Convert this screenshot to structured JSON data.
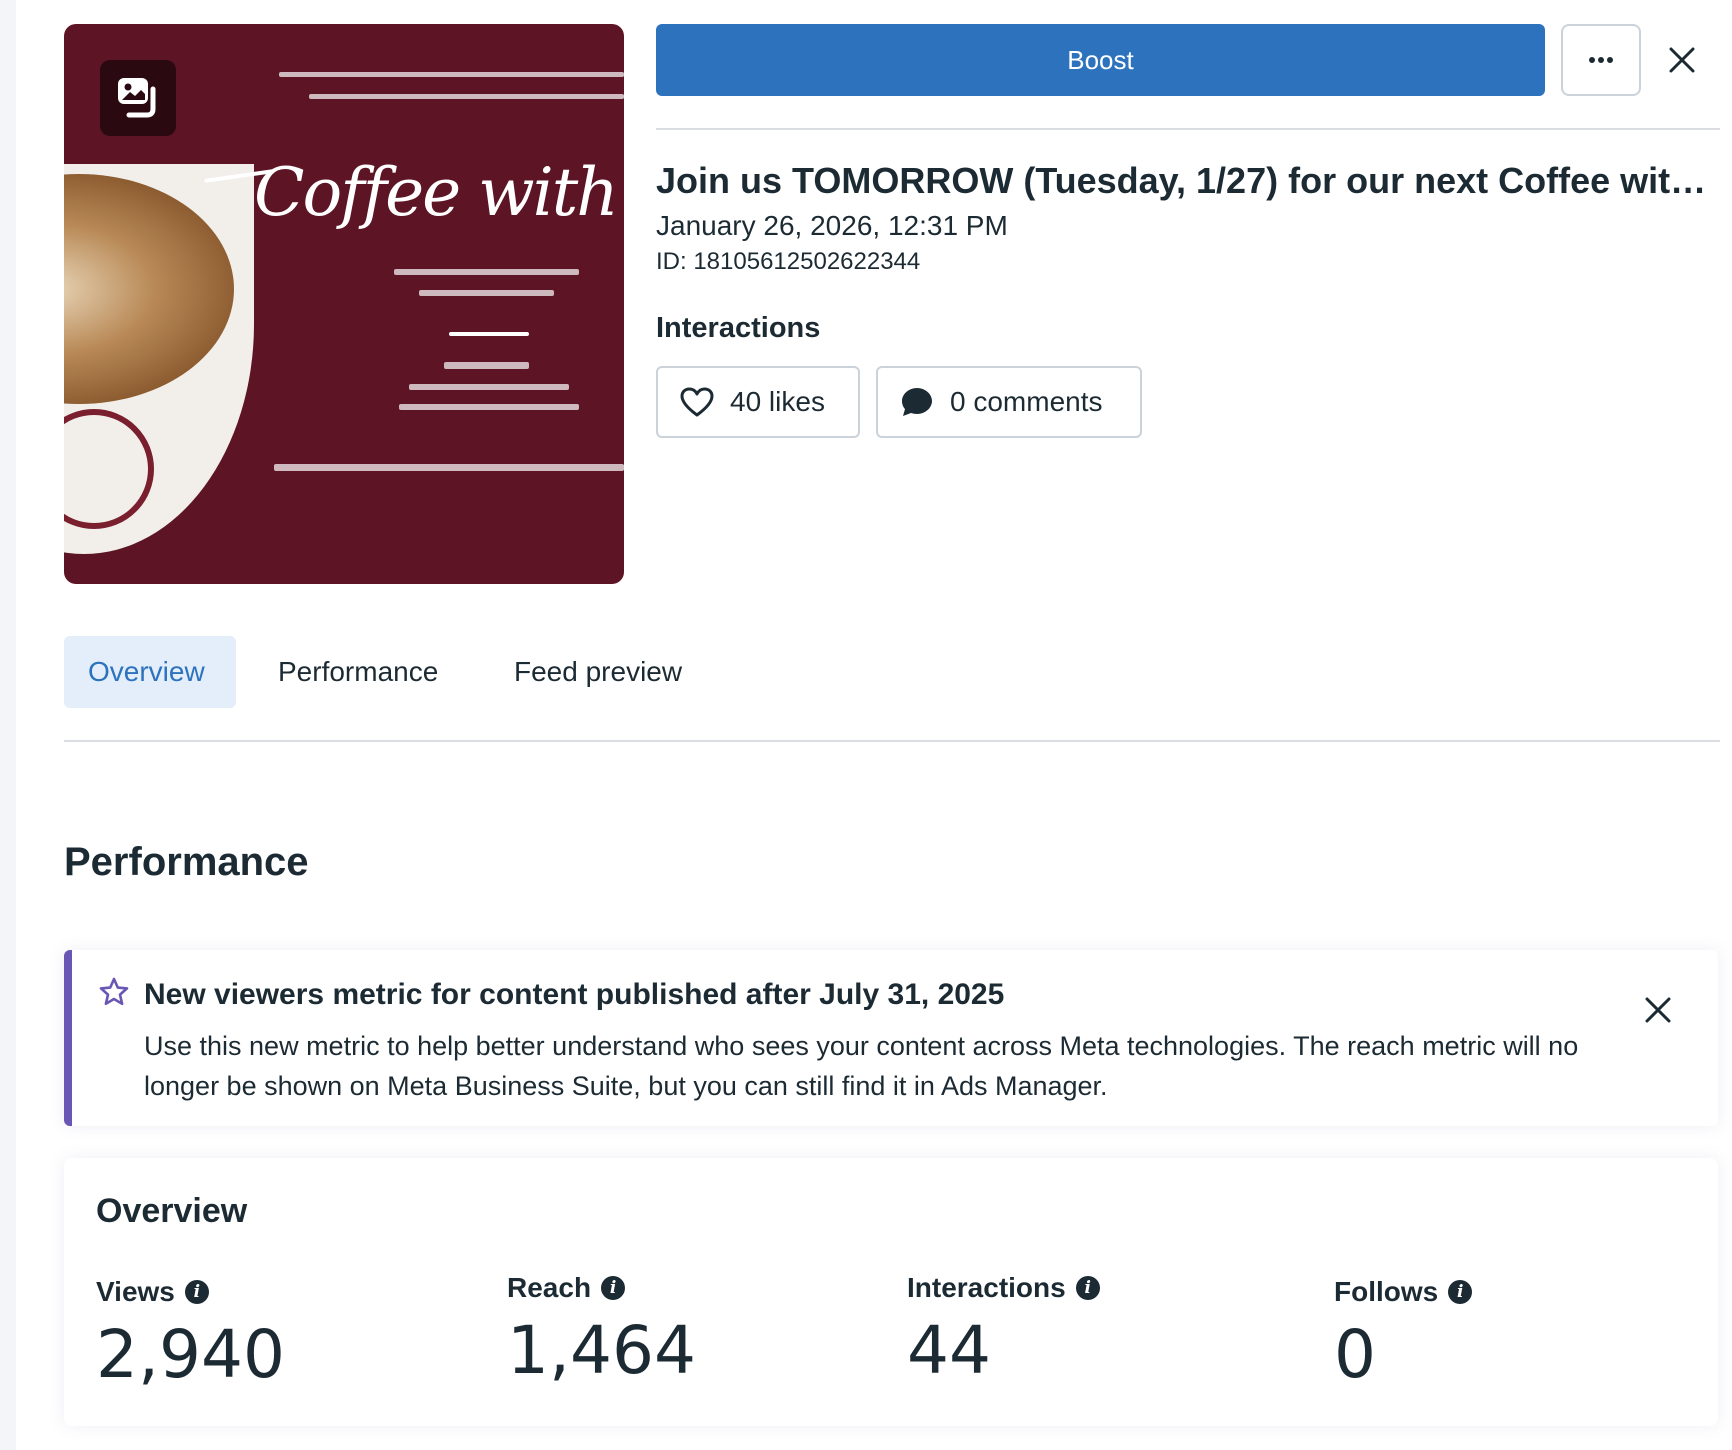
{
  "post": {
    "image_badge_icon": "gallery-icon",
    "image_text": {
      "script": "Coffee with Camp"
    },
    "title": "Join us TOMORROW (Tuesday, 1/27) for our next Coffee with …",
    "date": "January 26, 2026, 12:31 PM",
    "id": "ID: 18105612502622344"
  },
  "actions": {
    "boost_label": "Boost",
    "more_icon": "ellipsis-icon",
    "close_icon": "close-icon"
  },
  "interactions": {
    "label": "Interactions",
    "likes": "40 likes",
    "comments": "0 comments"
  },
  "tabs": [
    {
      "label": "Overview",
      "active": true
    },
    {
      "label": "Performance",
      "active": false
    },
    {
      "label": "Feed preview",
      "active": false
    }
  ],
  "performance": {
    "title": "Performance",
    "notice": {
      "title": "New viewers metric for content published after July 31, 2025",
      "body": "Use this new metric to help better understand who sees your content across Meta technologies. The reach metric will no longer be shown on Meta Business Suite, but you can still find it in Ads Manager."
    }
  },
  "overview": {
    "title": "Overview",
    "metrics": [
      {
        "label": "Views",
        "value": "2,940"
      },
      {
        "label": "Reach",
        "value": "1,464"
      },
      {
        "label": "Interactions",
        "value": "44"
      },
      {
        "label": "Follows",
        "value": "0"
      }
    ]
  },
  "colors": {
    "accent": "#2d72bd",
    "active_tab_bg": "#e3eefa",
    "notice_border": "#6a56b4",
    "image_bg": "#5d1525"
  }
}
